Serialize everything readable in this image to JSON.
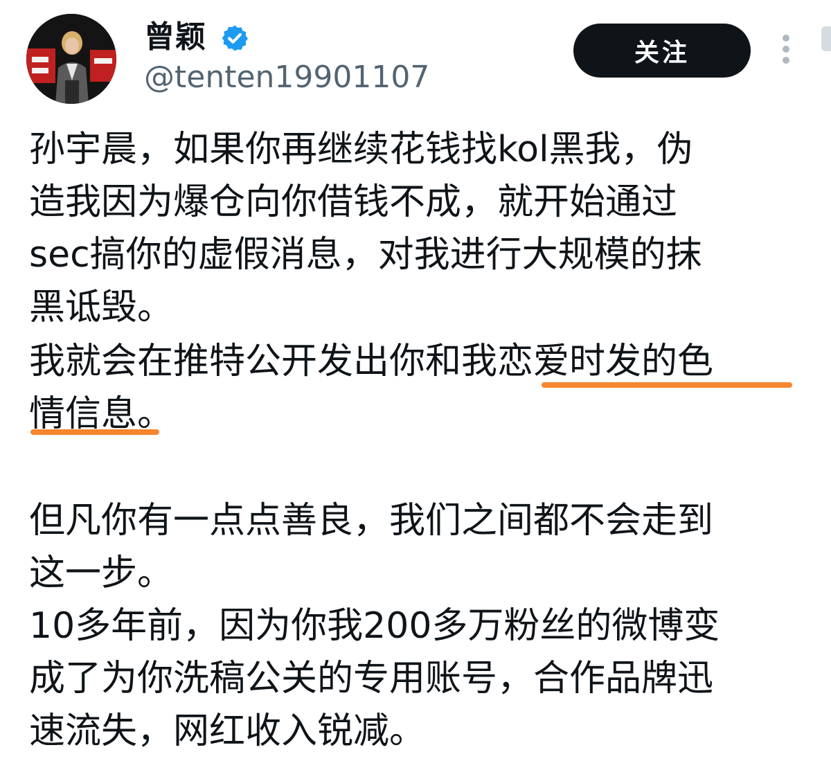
{
  "author": {
    "display_name": "曾颖",
    "handle": "@tenten19901107",
    "verified_icon": "verified-badge-icon",
    "avatar_icon": "profile-photo-icon"
  },
  "actions": {
    "follow_label": "关注",
    "more_icon": "more-vertical-icon"
  },
  "colors": {
    "text": "#0f1419",
    "handle": "#536471",
    "verified": "#1d9bf0",
    "follow_bg": "#0f1419",
    "highlight_underline": "#f5862d"
  },
  "post": {
    "lines": [
      "孙宇晨，如果你再继续花钱找kol黑我，伪",
      "造我因为爆仓向你借钱不成，就开始通过",
      "sec搞你的虚假消息，对我进行大规模的抹",
      "黑诋毁。",
      "我就会在推特公开发出你和我恋爱时发的色",
      "情信息。",
      "但凡你有一点点善良，我们之间都不会走到",
      "这一步。",
      "10多年前，因为你我200多万粉丝的微博变",
      "成了为你洗稿公关的专用账号，合作品牌迅",
      "速流失，网红收入锐减。"
    ],
    "highlighted_phrase": "恋爱时发的色情信息"
  }
}
